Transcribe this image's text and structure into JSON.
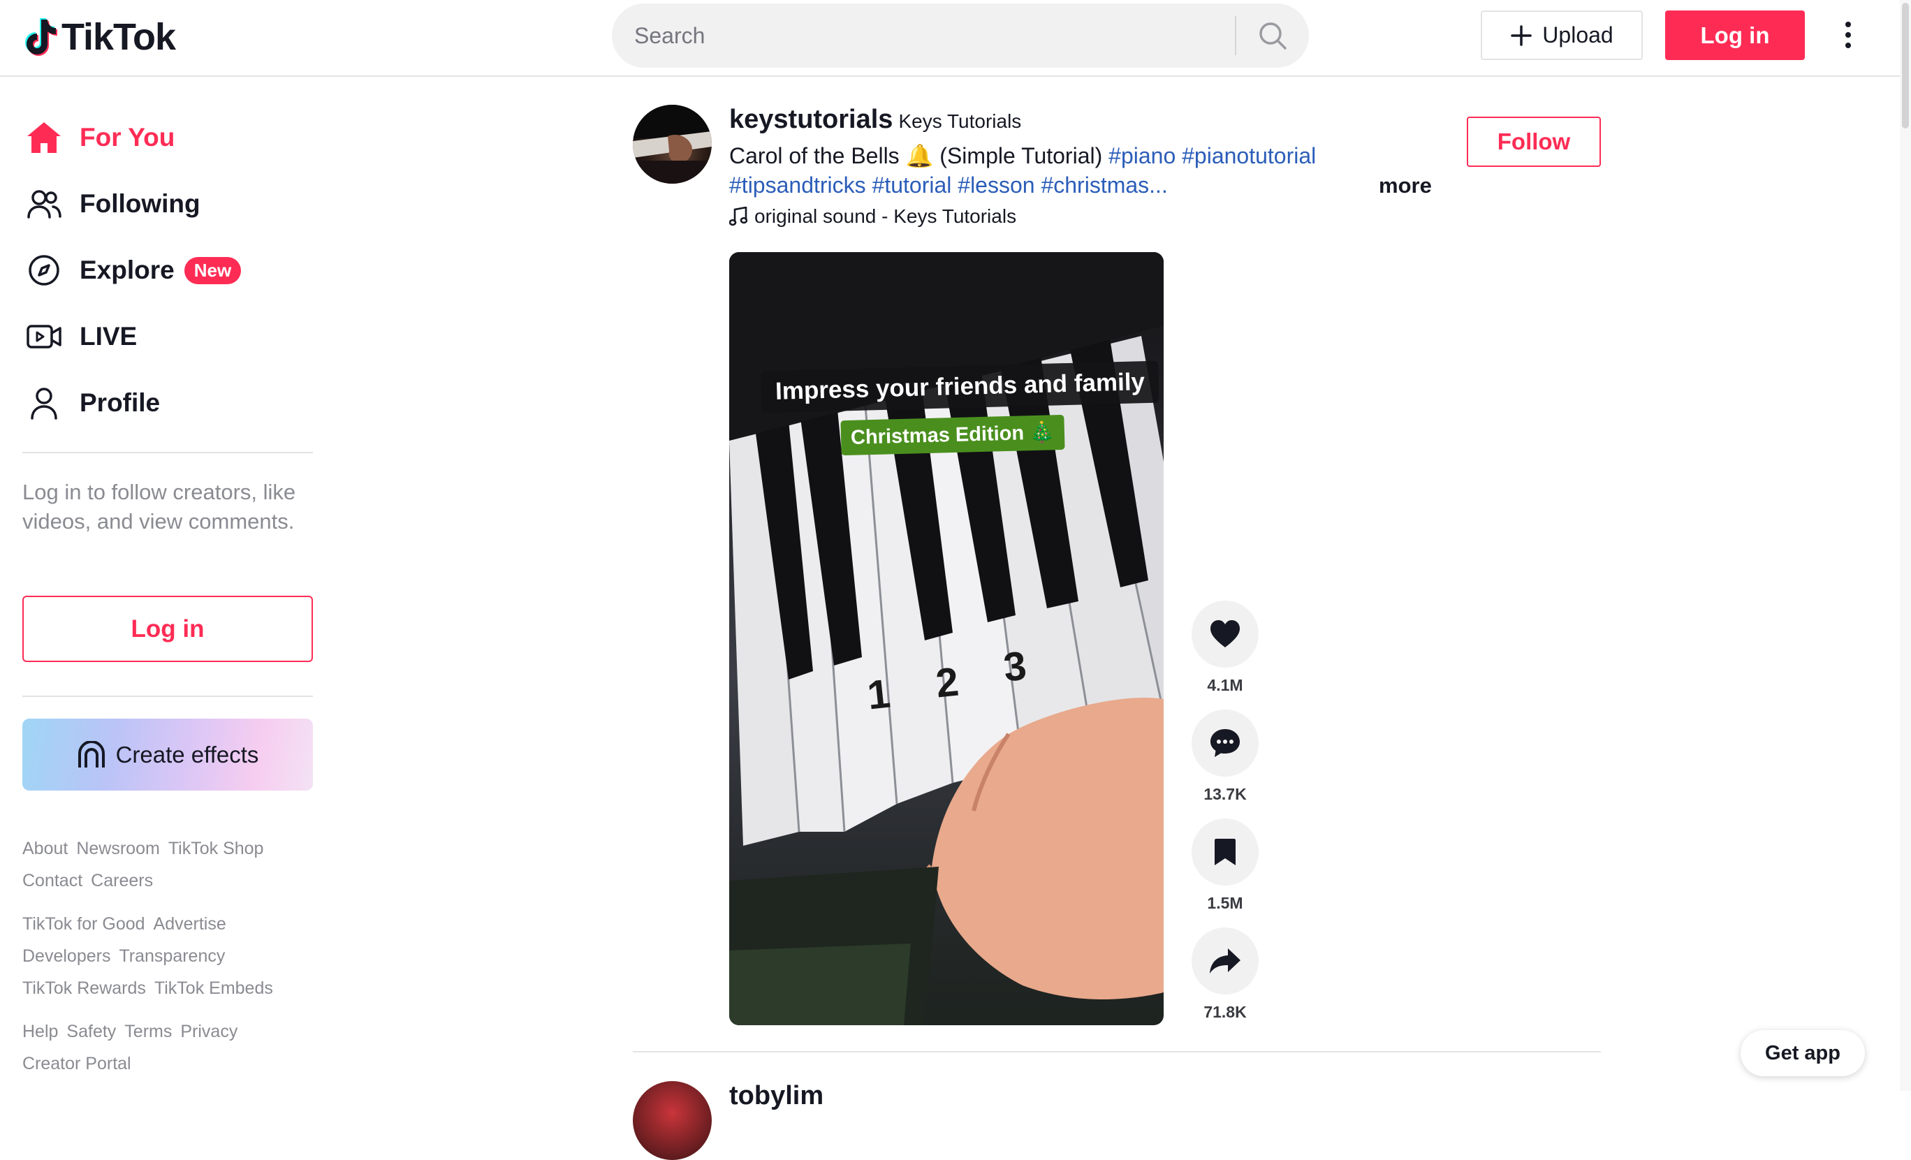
{
  "app": {
    "name": "TikTok"
  },
  "header": {
    "search_placeholder": "Search",
    "upload_label": "Upload",
    "login_label": "Log in"
  },
  "sidebar": {
    "nav": [
      {
        "label": "For You",
        "icon": "home-icon",
        "active": true
      },
      {
        "label": "Following",
        "icon": "following-icon"
      },
      {
        "label": "Explore",
        "icon": "compass-icon",
        "badge": "New"
      },
      {
        "label": "LIVE",
        "icon": "live-icon"
      },
      {
        "label": "Profile",
        "icon": "profile-icon"
      }
    ],
    "login_prompt": "Log in to follow creators, like videos, and view comments.",
    "login_label": "Log in",
    "effects_label": "Create effects",
    "footer": [
      [
        "About",
        "Newsroom",
        "TikTok Shop"
      ],
      [
        "Contact",
        "Careers"
      ],
      [
        "TikTok for Good",
        "Advertise"
      ],
      [
        "Developers",
        "Transparency"
      ],
      [
        "TikTok Rewards",
        "TikTok Embeds"
      ],
      [
        "Help",
        "Safety",
        "Terms",
        "Privacy"
      ],
      [
        "Creator Portal"
      ]
    ]
  },
  "post": {
    "username": "keystutorials",
    "nickname": "Keys Tutorials",
    "caption_text": "Carol of the Bells 🔔 (Simple Tutorial) ",
    "hashtags_line1": "#piano #pianotutorial",
    "hashtags_line2": "#tipsandtricks #tutorial #lesson #christmas...",
    "more_label": "more",
    "sound": "original sound - Keys Tutorials",
    "follow_label": "Follow",
    "video": {
      "overlay_title": "Impress your friends and family",
      "overlay_subtitle": "Christmas Edition 🎄",
      "key_numbers": [
        "1",
        "2",
        "3"
      ]
    },
    "stats": {
      "likes": "4.1M",
      "comments": "13.7K",
      "saves": "1.5M",
      "shares": "71.8K"
    }
  },
  "next_post": {
    "username": "tobylim"
  },
  "get_app_label": "Get app",
  "colors": {
    "brand": "#fe2c55",
    "hashtag": "#2b5db9",
    "text": "#161823"
  }
}
